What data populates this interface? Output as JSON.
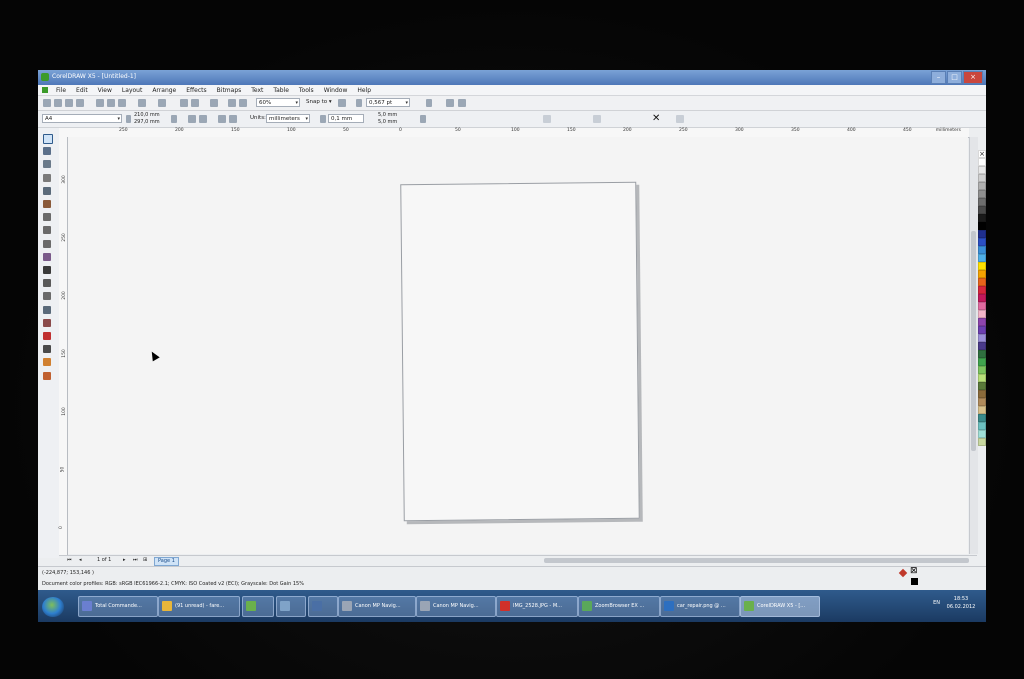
{
  "window": {
    "title": "CorelDRAW X5 - [Untitled-1]"
  },
  "menu": [
    "File",
    "Edit",
    "View",
    "Layout",
    "Arrange",
    "Effects",
    "Bitmaps",
    "Text",
    "Table",
    "Tools",
    "Window",
    "Help"
  ],
  "standard_toolbar": {
    "zoom": "60%",
    "snap_to": "Snap to",
    "outline_width": "0,567 pt"
  },
  "property_bar": {
    "paper": "A4",
    "width": "210,0 mm",
    "height": "297,0 mm",
    "units_label": "Units:",
    "units": "millimeters",
    "nudge": "0,1 mm",
    "dup_x": "5,0 mm",
    "dup_y": "5,0 mm"
  },
  "rulers": {
    "h_ticks": [
      "250",
      "200",
      "150",
      "100",
      "50",
      "0",
      "50",
      "100",
      "150",
      "200",
      "250",
      "300",
      "350",
      "400",
      "450"
    ],
    "v_ticks": [
      "300",
      "250",
      "200",
      "150",
      "100",
      "50",
      "0"
    ],
    "unit": "millimeters"
  },
  "page_nav": {
    "counter": "1 of 1",
    "tab": "Page 1"
  },
  "status": {
    "coords": "(-224,877; 153,146 )",
    "color_profiles": "Document color profiles: RGB: sRGB IEC61966-2.1; CMYK: ISO Coated v2 (ECI); Grayscale: Dot Gain 15%"
  },
  "palette": [
    "#ffffff",
    "#e8e8e8",
    "#cfcfcf",
    "#b0b0b0",
    "#909090",
    "#6e6e6e",
    "#4a4a4a",
    "#1a1a1a",
    "#000000",
    "#1f2f8f",
    "#2b4fc4",
    "#3a8fd8",
    "#4fb0e8",
    "#ffe100",
    "#f5a300",
    "#e8641a",
    "#d7263d",
    "#c2185b",
    "#e06aa0",
    "#f4b6c8",
    "#8e44ad",
    "#6c3fb0",
    "#9b8fd8",
    "#4a3a8a",
    "#2f6f3f",
    "#3fa34d",
    "#7cc35f",
    "#b8e07a",
    "#5a7a3a",
    "#8a6a3a",
    "#b08a5a",
    "#d8c08a",
    "#3a8a8a",
    "#6cc0c0",
    "#a0e0d8",
    "#c8d8a0"
  ],
  "taskbar": {
    "tasks": [
      {
        "label": "Total Commande...",
        "color": "#6a7fd0"
      },
      {
        "label": "(91 unread) - fare...",
        "color": "#e8b63a"
      },
      {
        "label": "",
        "color": "#6ab04c"
      },
      {
        "label": "",
        "color": "#7fa3c8"
      },
      {
        "label": "",
        "color": "#4a6fa5"
      },
      {
        "label": "Canon MP Navig...",
        "color": "#9aa5b5"
      },
      {
        "label": "Canon MP Navig...",
        "color": "#9aa5b5"
      },
      {
        "label": "IMG_2528.JPG - M...",
        "color": "#d0302a"
      },
      {
        "label": "ZoomBrowser EX ...",
        "color": "#5aa85a"
      },
      {
        "label": "car_repair.png @ ...",
        "color": "#2d6fc0"
      },
      {
        "label": "CorelDRAW X5 - [...",
        "color": "#6ab04c"
      }
    ],
    "lang": "EN",
    "time": "18:53",
    "date": "06.02.2012"
  }
}
